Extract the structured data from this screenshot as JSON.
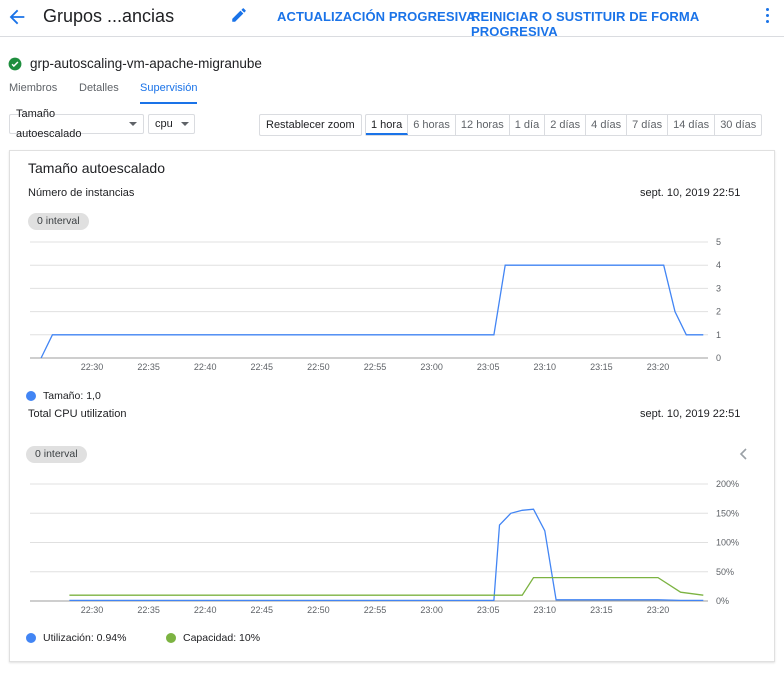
{
  "header": {
    "title": "Grupos ...ancias",
    "rolling_update": "ACTUALIZACIÓN PROGRESIVA",
    "rolling_replace": "REINICIAR O SUSTITUIR DE FORMA PROGRESIVA"
  },
  "group": {
    "name": "grp-autoscaling-vm-apache-migranube",
    "status_color": "#1e8e3e"
  },
  "tabs": [
    {
      "label": "Miembros"
    },
    {
      "label": "Detalles"
    },
    {
      "label": "Supervisión",
      "active": true
    }
  ],
  "controls": {
    "metric_select": "Tamaño autoescalado",
    "cpu_select": "cpu",
    "reset_zoom": "Restablecer zoom",
    "ranges": [
      "1 hora",
      "6 horas",
      "12 horas",
      "1 día",
      "2 días",
      "4 días",
      "7 días",
      "14 días",
      "30 días"
    ],
    "active_range": "1 hora"
  },
  "card": {
    "title": "Tamaño autoescalado",
    "size_chart": {
      "metric": "Número de instancias",
      "timestamp": "sept. 10, 2019 22:51",
      "interval": "0 interval",
      "legend": "Tamaño: 1,0"
    },
    "cpu_chart": {
      "metric": "Total CPU utilization",
      "timestamp": "sept. 10, 2019 22:51",
      "interval": "0 interval",
      "legend_util": "Utilización: 0.94%",
      "legend_cap": "Capacidad: 10%"
    }
  },
  "colors": {
    "accent": "#1a73e8",
    "series_blue": "#4285f4",
    "series_green": "#7cb342"
  },
  "chart_data": [
    {
      "type": "line",
      "x_ticks": [
        "22:30",
        "22:35",
        "22:40",
        "22:45",
        "22:50",
        "22:55",
        "23:00",
        "23:05",
        "23:10",
        "23:15",
        "23:20"
      ],
      "y_ticks": [
        "0",
        "1",
        "2",
        "3",
        "4",
        "5"
      ],
      "ylim": [
        0,
        5
      ],
      "xlim_minutes": [
        22.5,
        37.4
      ],
      "series": [
        {
          "name": "Tamaño",
          "color": "#4285f4",
          "points": [
            [
              25.5,
              0
            ],
            [
              26.5,
              1
            ],
            [
              65.5,
              1
            ],
            [
              66.5,
              4
            ],
            [
              80.5,
              4
            ],
            [
              81.5,
              2
            ],
            [
              82.5,
              1
            ],
            [
              84,
              1
            ]
          ]
        }
      ]
    },
    {
      "type": "line",
      "x_ticks": [
        "22:30",
        "22:35",
        "22:40",
        "22:45",
        "22:50",
        "22:55",
        "23:00",
        "23:05",
        "23:10",
        "23:15",
        "23:20"
      ],
      "y_ticks": [
        "0%",
        "50%",
        "100%",
        "150%",
        "200%"
      ],
      "ylim": [
        0,
        200
      ],
      "series": [
        {
          "name": "Utilización",
          "color": "#4285f4",
          "points": [
            [
              28,
              1
            ],
            [
              64,
              1
            ],
            [
              65.5,
              1
            ],
            [
              66,
              130
            ],
            [
              67,
              150
            ],
            [
              68,
              155
            ],
            [
              69,
              157
            ],
            [
              70,
              120
            ],
            [
              71,
              2
            ],
            [
              80,
              2
            ],
            [
              82,
              1
            ],
            [
              84,
              1
            ]
          ]
        },
        {
          "name": "Capacidad",
          "color": "#7cb342",
          "points": [
            [
              28,
              10
            ],
            [
              68,
              10
            ],
            [
              69,
              40
            ],
            [
              80,
              40
            ],
            [
              82,
              15
            ],
            [
              84,
              10
            ]
          ]
        }
      ]
    }
  ]
}
